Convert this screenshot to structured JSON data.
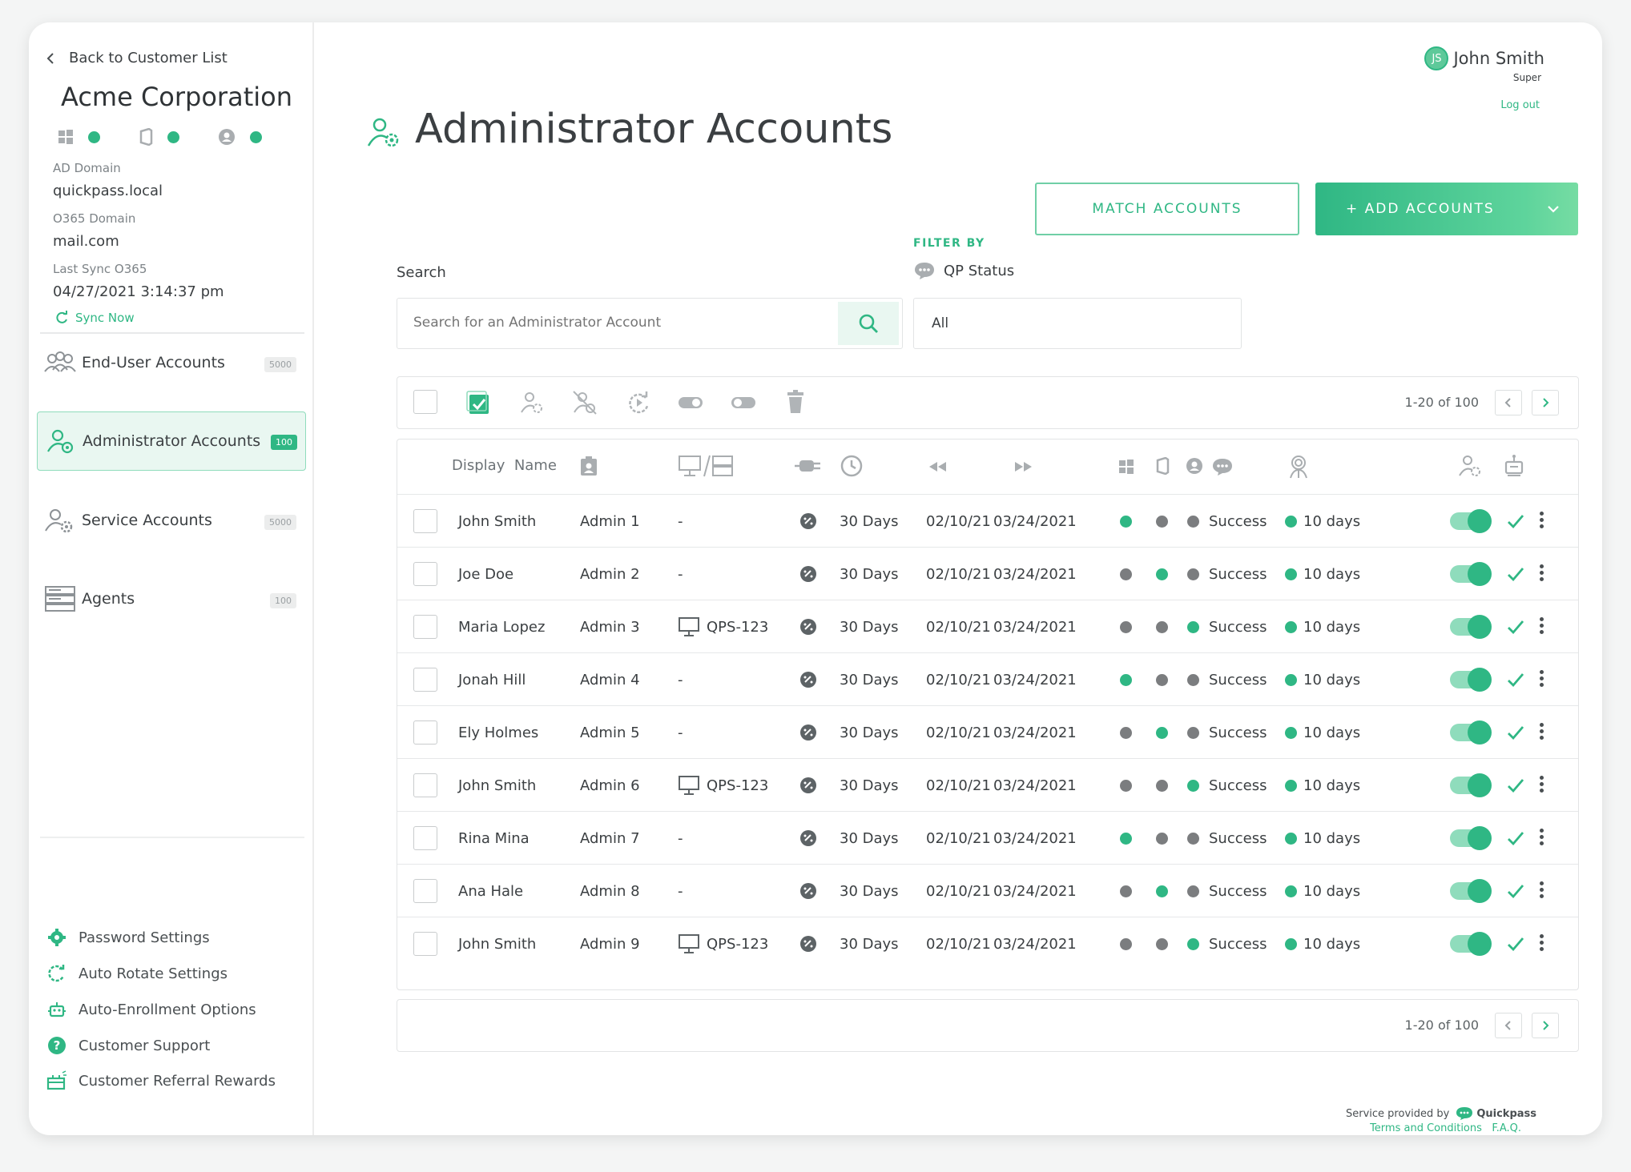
{
  "sidebar": {
    "back_label": "Back to Customer List",
    "company": "Acme Corporation",
    "ad_domain_label": "AD Domain",
    "ad_domain_value": "quickpass.local",
    "o365_domain_label": "O365 Domain",
    "o365_domain_value": "mail.com",
    "last_sync_label": "Last Sync O365",
    "last_sync_value": "04/27/2021 3:14:37 pm",
    "sync_now": "Sync Now",
    "nav": [
      {
        "label": "End-User Accounts",
        "badge": "5000"
      },
      {
        "label": "Administrator Accounts",
        "badge": "100"
      },
      {
        "label": "Service Accounts",
        "badge": "5000"
      },
      {
        "label": "Agents",
        "badge": "100"
      }
    ],
    "bottom_links": [
      {
        "label": "Password Settings",
        "icon": "gear-icon"
      },
      {
        "label": "Auto Rotate Settings",
        "icon": "rotate-icon"
      },
      {
        "label": "Auto-Enrollment Options",
        "icon": "robot-icon"
      },
      {
        "label": "Customer Support",
        "icon": "question-icon"
      },
      {
        "label": "Customer Referral Rewards",
        "icon": "gift-icon"
      }
    ]
  },
  "user": {
    "initials": "JS",
    "name": "John Smith",
    "role": "Super",
    "logout": "Log out"
  },
  "page": {
    "title": "Administrator Accounts",
    "match_button": "MATCH ACCOUNTS",
    "add_button": "+ ADD ACCOUNTS",
    "search_label": "Search",
    "search_placeholder": "Search for an Administrator Account",
    "filter_by_label": "FILTER BY",
    "filter_field_label": "QP Status",
    "filter_value": "All",
    "pagination": "1-20 of 100"
  },
  "table": {
    "header_display": "Display",
    "header_name": "Name",
    "rows": [
      {
        "name": "John Smith",
        "admin": "Admin 1",
        "device": "-",
        "days": "30 Days",
        "d1": "02/10/21",
        "d2": "03/24/2021",
        "s1": "g",
        "s2": "d",
        "s3": "d",
        "status": "Success",
        "expiry": "10 days"
      },
      {
        "name": "Joe Doe",
        "admin": "Admin 2",
        "device": "-",
        "days": "30 Days",
        "d1": "02/10/21",
        "d2": "03/24/2021",
        "s1": "d",
        "s2": "g",
        "s3": "d",
        "status": "Success",
        "expiry": "10 days"
      },
      {
        "name": "Maria Lopez",
        "admin": "Admin 3",
        "device": "QPS-123",
        "days": "30 Days",
        "d1": "02/10/21",
        "d2": "03/24/2021",
        "s1": "d",
        "s2": "d",
        "s3": "g",
        "status": "Success",
        "expiry": "10 days"
      },
      {
        "name": "Jonah Hill",
        "admin": "Admin 4",
        "device": "-",
        "days": "30 Days",
        "d1": "02/10/21",
        "d2": "03/24/2021",
        "s1": "g",
        "s2": "d",
        "s3": "d",
        "status": "Success",
        "expiry": "10 days"
      },
      {
        "name": "Ely Holmes",
        "admin": "Admin 5",
        "device": "-",
        "days": "30 Days",
        "d1": "02/10/21",
        "d2": "03/24/2021",
        "s1": "d",
        "s2": "g",
        "s3": "d",
        "status": "Success",
        "expiry": "10 days"
      },
      {
        "name": "John Smith",
        "admin": "Admin 6",
        "device": "QPS-123",
        "days": "30 Days",
        "d1": "02/10/21",
        "d2": "03/24/2021",
        "s1": "d",
        "s2": "d",
        "s3": "g",
        "status": "Success",
        "expiry": "10 days"
      },
      {
        "name": "Rina Mina",
        "admin": "Admin 7",
        "device": "-",
        "days": "30 Days",
        "d1": "02/10/21",
        "d2": "03/24/2021",
        "s1": "g",
        "s2": "d",
        "s3": "d",
        "status": "Success",
        "expiry": "10 days"
      },
      {
        "name": "Ana Hale",
        "admin": "Admin 8",
        "device": "-",
        "days": "30 Days",
        "d1": "02/10/21",
        "d2": "03/24/2021",
        "s1": "d",
        "s2": "g",
        "s3": "d",
        "status": "Success",
        "expiry": "10 days"
      },
      {
        "name": "John Smith",
        "admin": "Admin 9",
        "device": "QPS-123",
        "days": "30 Days",
        "d1": "02/10/21",
        "d2": "03/24/2021",
        "s1": "d",
        "s2": "d",
        "s3": "g",
        "status": "Success",
        "expiry": "10 days"
      }
    ]
  },
  "footer": {
    "service_by": "Service provided by",
    "brand": "Quickpass",
    "terms": "Terms and Conditions",
    "faq": "F.A.Q."
  },
  "colors": {
    "accent": "#2fb784",
    "inactive": "#7b7d7f"
  }
}
